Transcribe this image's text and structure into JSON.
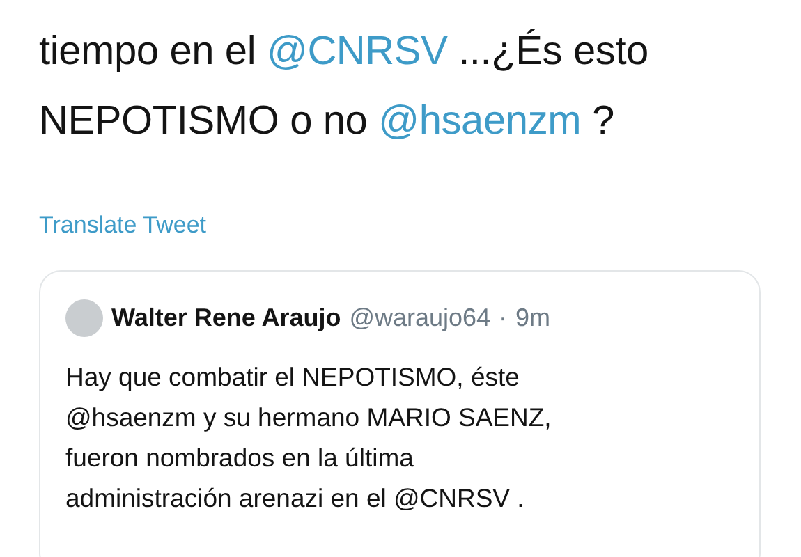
{
  "tweet": {
    "lines": [
      [
        {
          "kind": "text",
          "text": "tiempo en el "
        },
        {
          "kind": "mention",
          "text": "@CNRSV"
        },
        {
          "kind": "text",
          "text": " ...¿És esto"
        }
      ],
      [
        {
          "kind": "text",
          "text": "NEPOTISMO o no "
        },
        {
          "kind": "mention",
          "text": "@hsaenzm"
        },
        {
          "kind": "text",
          "text": " ?"
        }
      ]
    ],
    "translate_link": "Translate Tweet",
    "quoted_tweet": {
      "author_name": "Walter Rene Araujo",
      "handle": "@waraujo64",
      "separator": "·",
      "time": "9m",
      "lines": [
        "Hay que combatir el NEPOTISMO, éste",
        "@hsaenzm y su hermano MARIO SAENZ,",
        "fueron nombrados en la última",
        "administración arenazi en el @CNRSV ."
      ]
    }
  }
}
